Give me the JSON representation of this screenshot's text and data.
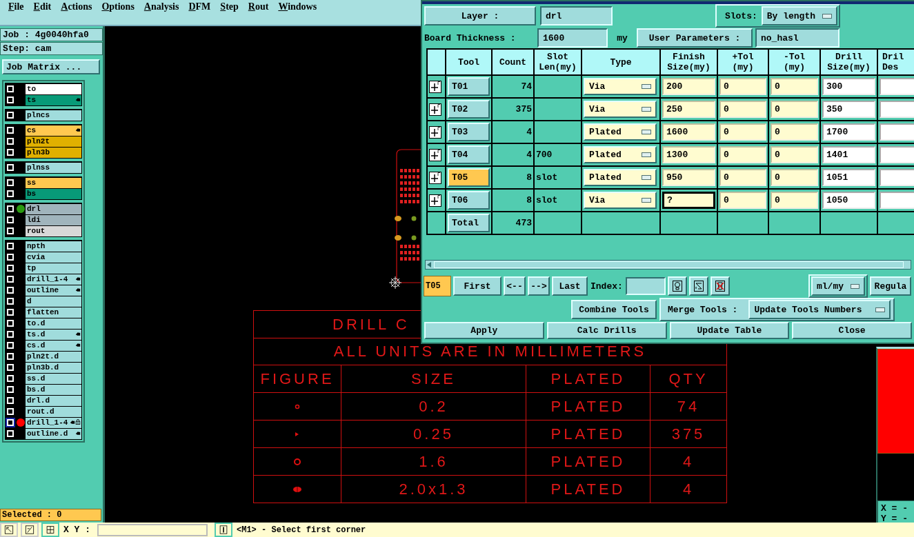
{
  "menu": [
    "File",
    "Edit",
    "Actions",
    "Options",
    "Analysis",
    "DFM",
    "Step",
    "Rout",
    "Windows"
  ],
  "job": "Job : 4g0040hfa0",
  "step": "Step: cam",
  "job_matrix_button": "Job Matrix ...",
  "layer_groups": [
    [
      {
        "name": "to",
        "color": "#ffffff",
        "checked": false,
        "pointer": false
      },
      {
        "name": "ts",
        "color": "#089a78",
        "checked": false,
        "pointer": true
      }
    ],
    [
      {
        "name": "plncs",
        "color": "#a0dcdc",
        "checked": false,
        "pointer": false
      }
    ],
    [
      {
        "name": "cs",
        "color": "#ffc850",
        "checked": false,
        "pointer": true
      },
      {
        "name": "pln2t",
        "color": "#e0b000",
        "checked": false,
        "pointer": false
      },
      {
        "name": "pln3b",
        "color": "#e0b000",
        "checked": false,
        "pointer": false
      }
    ],
    [
      {
        "name": "plnss",
        "color": "#a0dcdc",
        "checked": false,
        "pointer": false
      }
    ],
    [
      {
        "name": "ss",
        "color": "#ffc850",
        "checked": false,
        "pointer": false
      },
      {
        "name": "bs",
        "color": "#089a78",
        "checked": false,
        "pointer": false
      }
    ],
    [
      {
        "name": "drl",
        "color": "#a0b4bc",
        "checked": false,
        "pointer": false,
        "dot": {
          "color": "#2a9a10"
        }
      },
      {
        "name": "ldi",
        "color": "#a0b4bc",
        "checked": false,
        "pointer": false
      },
      {
        "name": "rout",
        "color": "#d8d8d8",
        "checked": false,
        "pointer": false
      }
    ],
    [
      {
        "name": "npth",
        "color": "#a0dcdc",
        "checked": false,
        "pointer": false
      },
      {
        "name": "cvia",
        "color": "#a0dcdc",
        "checked": false,
        "pointer": false
      },
      {
        "name": "tp",
        "color": "#a0dcdc",
        "checked": false,
        "pointer": false
      },
      {
        "name": "drill_1-4",
        "color": "#a0dcdc",
        "checked": false,
        "pointer": true
      },
      {
        "name": "outline",
        "color": "#a0dcdc",
        "checked": false,
        "pointer": true
      },
      {
        "name": "d",
        "color": "#a0dcdc",
        "checked": false,
        "pointer": false
      },
      {
        "name": "flatten",
        "color": "#a0dcdc",
        "checked": false,
        "pointer": false
      },
      {
        "name": "to.d",
        "color": "#a0dcdc",
        "checked": false,
        "pointer": false
      },
      {
        "name": "ts.d",
        "color": "#a0dcdc",
        "checked": false,
        "pointer": true
      },
      {
        "name": "cs.d",
        "color": "#a0dcdc",
        "checked": false,
        "pointer": true
      },
      {
        "name": "pln2t.d",
        "color": "#a0dcdc",
        "checked": false,
        "pointer": false
      },
      {
        "name": "pln3b.d",
        "color": "#a0dcdc",
        "checked": false,
        "pointer": false
      },
      {
        "name": "ss.d",
        "color": "#a0dcdc",
        "checked": false,
        "pointer": false
      },
      {
        "name": "bs.d",
        "color": "#a0dcdc",
        "checked": false,
        "pointer": false
      },
      {
        "name": "drl.d",
        "color": "#a0dcdc",
        "checked": false,
        "pointer": false
      },
      {
        "name": "rout.d",
        "color": "#a0dcdc",
        "checked": false,
        "pointer": false
      },
      {
        "name": "drill_1-4",
        "color": "#a0dcdc",
        "checked": false,
        "pointer": true,
        "dot": {
          "color": "#ff0000"
        },
        "locked": true,
        "active": true
      },
      {
        "name": "outline.d",
        "color": "#a0dcdc",
        "checked": false,
        "pointer": true
      }
    ]
  ],
  "selected_count": "Selected : 0",
  "drill_chart": {
    "title": "DRILL C",
    "subtitle": "ALL UNITS ARE IN MILLIMETERS",
    "columns": [
      "FIGURE",
      "SIZE",
      "PLATED",
      "QTY"
    ],
    "rows": [
      {
        "kind": "small-dot",
        "size": "0.2",
        "plating": "PLATED",
        "qty": "74"
      },
      {
        "kind": "dot",
        "size": "0.25",
        "plating": "PLATED",
        "qty": "375"
      },
      {
        "kind": "ring",
        "size": "1.6",
        "plating": "PLATED",
        "qty": "4"
      },
      {
        "kind": "slot",
        "size": "2.0x1.3",
        "plating": "PLATED",
        "qty": "4"
      }
    ]
  },
  "dialog": {
    "layer_label": "Layer :",
    "layer": "drl",
    "slots_label": "Slots:",
    "slots": "By length",
    "thickness_label": "Board Thickness :",
    "thickness": "1600",
    "thickness_unit": "my",
    "user_params_button": "User Parameters :",
    "user_params": "no_hasl",
    "columns": [
      "Tool",
      "Count",
      "Slot\nLen(my)",
      "Type",
      "Finish\nSize(my)",
      "+Tol\n(my)",
      "-Tol\n(my)",
      "Drill\nSize(my)",
      "Dril\nDes"
    ],
    "tools": [
      {
        "tool": "T01",
        "selected": false,
        "count": "74",
        "type": "Via",
        "finish": "200",
        "focused": false,
        "plus_tol": "0",
        "minus_tol": "0",
        "drill_size": "300"
      },
      {
        "tool": "T02",
        "selected": false,
        "count": "375",
        "type": "Via",
        "finish": "250",
        "focused": false,
        "plus_tol": "0",
        "minus_tol": "0",
        "drill_size": "350"
      },
      {
        "tool": "T03",
        "selected": false,
        "count": "4",
        "type": "Plated",
        "finish": "1600",
        "focused": false,
        "plus_tol": "0",
        "minus_tol": "0",
        "drill_size": "1700"
      },
      {
        "tool": "T04",
        "selected": false,
        "count": "4",
        "slot_len": "700",
        "type": "Plated",
        "finish": "1300",
        "focused": false,
        "plus_tol": "0",
        "minus_tol": "0",
        "drill_size": "1401"
      },
      {
        "tool": "T05",
        "selected": true,
        "count": "8",
        "slot_len": "slot",
        "type": "Plated",
        "finish": "950",
        "focused": false,
        "plus_tol": "0",
        "minus_tol": "0",
        "drill_size": "1051"
      },
      {
        "tool": "T06",
        "selected": false,
        "count": "8",
        "slot_len": "slot",
        "type": "Via",
        "finish": "?",
        "focused": true,
        "plus_tol": "0",
        "minus_tol": "0",
        "drill_size": "1050"
      }
    ],
    "total_label": "Total",
    "total_count": "473",
    "current_tool": "T05",
    "nav_buttons": [
      "First",
      "<--",
      "-->",
      "Last"
    ],
    "index_label": "Index:",
    "units": "ml/my",
    "regula_button": "Regula",
    "combine_button": "Combine Tools",
    "merge_label": "Merge Tools :",
    "merge": "Update Tools Numbers",
    "actions": [
      "Apply",
      "Calc Drills",
      "Update Table",
      "Close"
    ]
  },
  "coords": {
    "x": "X = -",
    "y": "Y = -"
  },
  "status_bar": {
    "xy_label": "X Y :",
    "message": "<M1> - Select first corner"
  }
}
